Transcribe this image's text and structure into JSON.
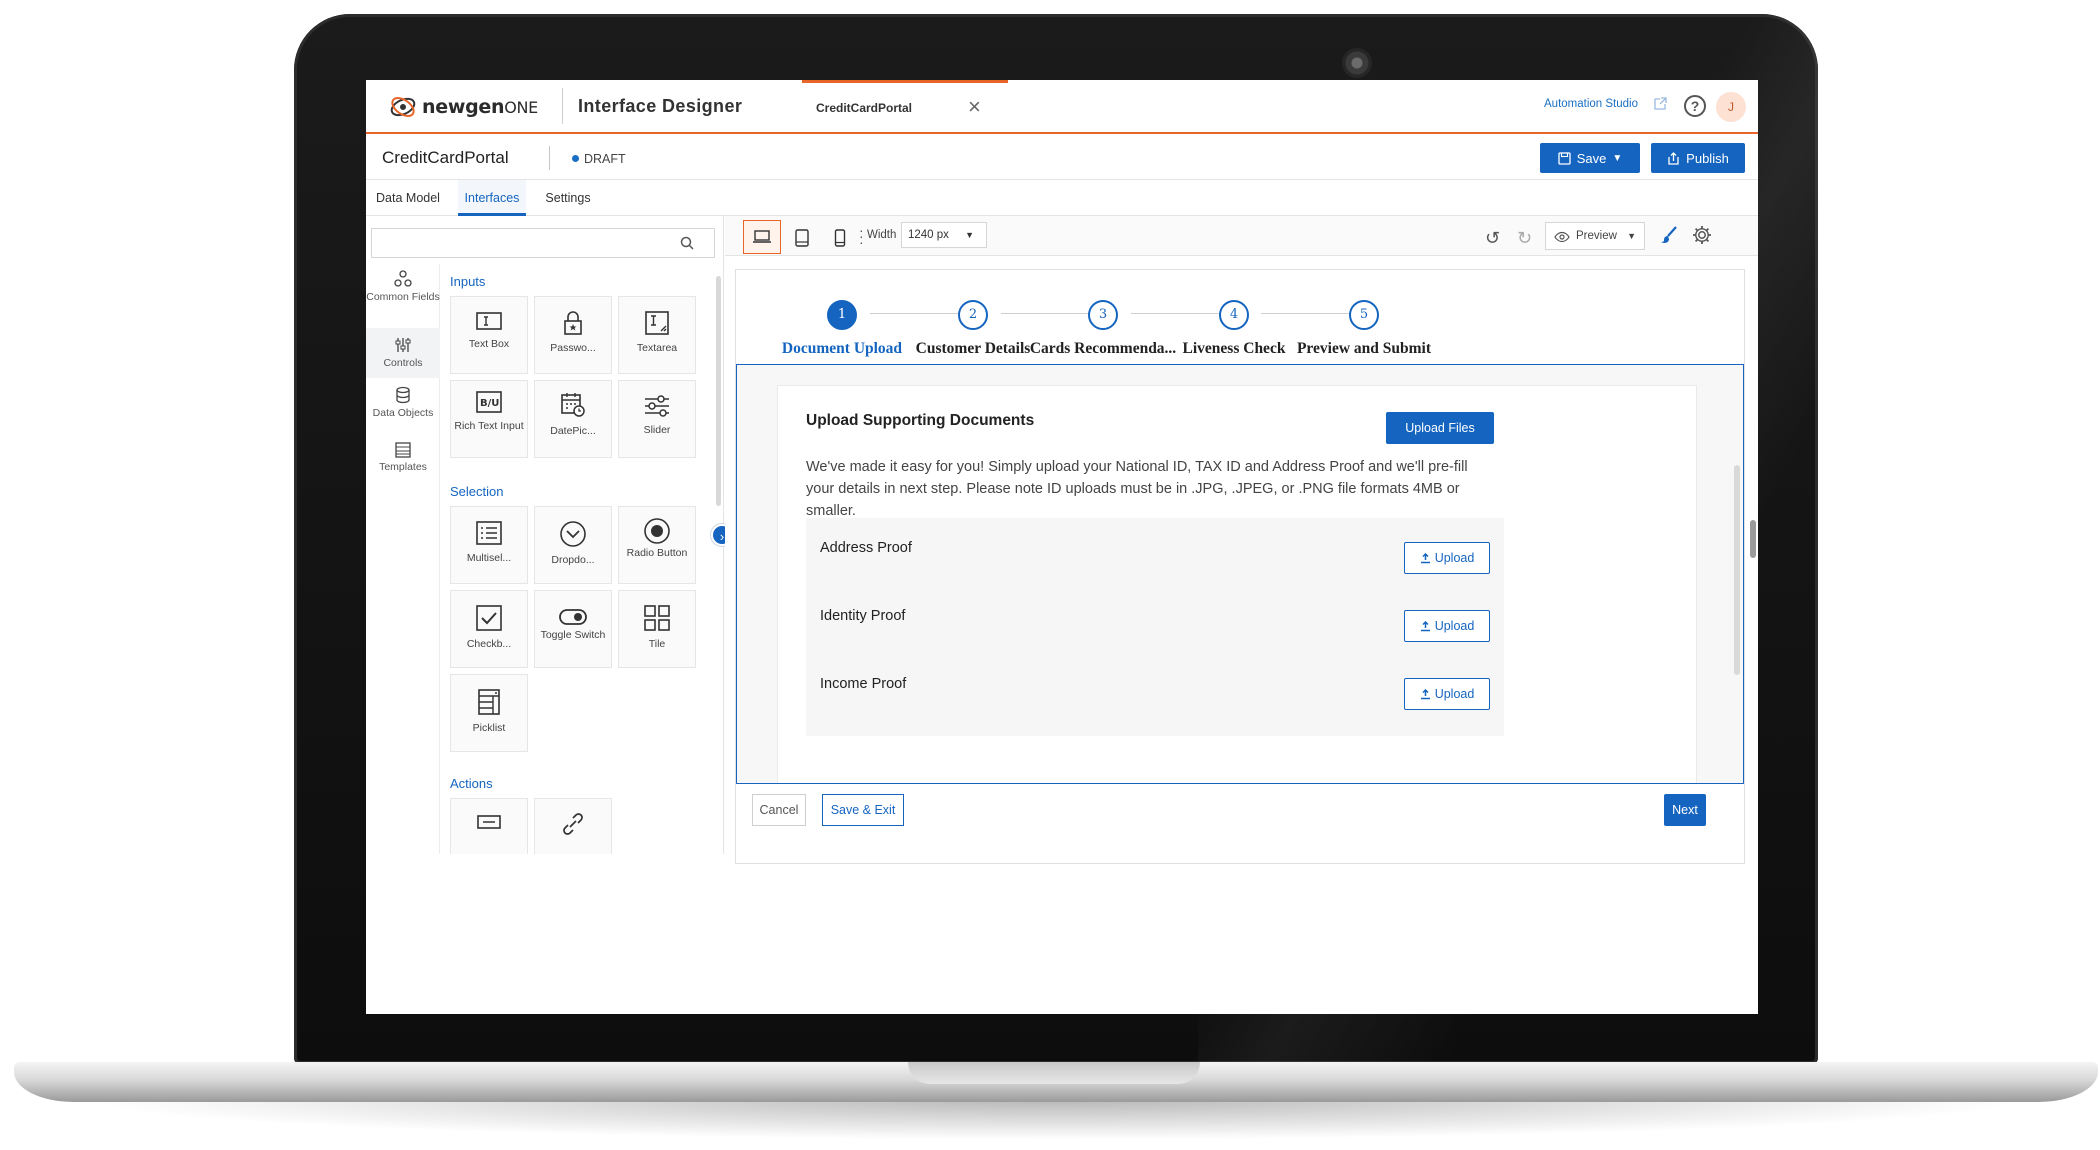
{
  "header": {
    "logo_text_bold": "newgen",
    "logo_text_suffix": "ONE",
    "app_title": "Interface Designer",
    "open_tab": "CreditCardPortal",
    "automation_studio_link": "Automation Studio",
    "user_initial": "J",
    "accent_color": "#e8652a"
  },
  "project": {
    "name": "CreditCardPortal",
    "status": "DRAFT",
    "save_label": "Save",
    "publish_label": "Publish"
  },
  "nav_tabs": [
    {
      "label": "Data Model",
      "active": false
    },
    {
      "label": "Interfaces",
      "active": true
    },
    {
      "label": "Settings",
      "active": false
    }
  ],
  "sidebar": {
    "search_placeholder": "",
    "categories": [
      {
        "label": "Common Fields",
        "icon": "common-fields-icon",
        "active": false
      },
      {
        "label": "Controls",
        "icon": "controls-icon",
        "active": true
      },
      {
        "label": "Data Objects",
        "icon": "database-icon",
        "active": false
      },
      {
        "label": "Templates",
        "icon": "templates-icon",
        "active": false
      }
    ],
    "groups": [
      {
        "title": "Inputs",
        "items": [
          {
            "label": "Text Box",
            "icon": "text-box-icon"
          },
          {
            "label": "Passwo...",
            "icon": "password-icon"
          },
          {
            "label": "Textarea",
            "icon": "textarea-icon"
          },
          {
            "label": "Rich Text Input",
            "icon": "rich-text-icon"
          },
          {
            "label": "DatePic...",
            "icon": "date-picker-icon"
          },
          {
            "label": "Slider",
            "icon": "slider-icon"
          }
        ]
      },
      {
        "title": "Selection",
        "items": [
          {
            "label": "Multisel...",
            "icon": "multiselect-icon"
          },
          {
            "label": "Dropdo...",
            "icon": "dropdown-icon"
          },
          {
            "label": "Radio Button",
            "icon": "radio-button-icon"
          },
          {
            "label": "Checkb...",
            "icon": "checkbox-icon"
          },
          {
            "label": "Toggle Switch",
            "icon": "toggle-switch-icon"
          },
          {
            "label": "Tile",
            "icon": "tile-icon"
          },
          {
            "label": "Picklist",
            "icon": "picklist-icon"
          }
        ]
      },
      {
        "title": "Actions",
        "items": [
          {
            "label": "",
            "icon": "button-icon"
          },
          {
            "label": "",
            "icon": "link-icon"
          }
        ]
      }
    ]
  },
  "canvas_toolbar": {
    "devices": [
      "desktop",
      "tablet",
      "mobile"
    ],
    "active_device": "desktop",
    "width_label": "Width",
    "width_value": "1240 px",
    "preview_label": "Preview"
  },
  "stepper": [
    {
      "number": "1",
      "label": "Document Upload",
      "active": true
    },
    {
      "number": "2",
      "label": "Customer Details",
      "active": false
    },
    {
      "number": "3",
      "label": "Cards Recommenda...",
      "active": false
    },
    {
      "number": "4",
      "label": "Liveness Check",
      "active": false
    },
    {
      "number": "5",
      "label": "Preview and Submit",
      "active": false
    }
  ],
  "form": {
    "title": "Upload Supporting Documents",
    "upload_files_label": "Upload Files",
    "description": "We've made it easy for you! Simply upload your National ID, TAX ID and Address Proof and we'll pre-fill your details in next step. Please note ID uploads must be in .JPG, .JPEG, or .PNG file formats 4MB or smaller.",
    "documents": [
      {
        "label": "Address Proof",
        "button": "Upload"
      },
      {
        "label": "Identity Proof",
        "button": "Upload"
      },
      {
        "label": "Income Proof",
        "button": "Upload"
      }
    ]
  },
  "footer": {
    "cancel_label": "Cancel",
    "save_exit_label": "Save & Exit",
    "next_label": "Next"
  }
}
